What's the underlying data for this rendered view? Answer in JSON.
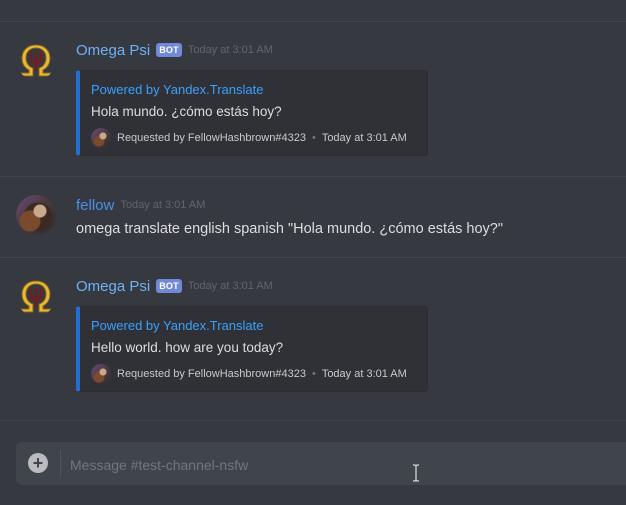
{
  "channel": {
    "composer_placeholder": "Message #test-channel-nsfw"
  },
  "messages": [
    {
      "author": "Omega Psi",
      "bot_tag": "BOT",
      "timestamp": "Today at 3:01 AM",
      "embed": {
        "title": "Powered by Yandex.Translate",
        "description": "Hola mundo. ¿cómo estás hoy?",
        "footer_text": "Requested by FellowHashbrown#4323",
        "footer_separator": "•",
        "footer_timestamp": "Today at 3:01 AM",
        "accent_color": "#1f6fd6"
      }
    },
    {
      "author": "fellow",
      "timestamp": "Today at 3:01 AM",
      "content": "omega translate english spanish \"Hola mundo. ¿cómo estás hoy?\""
    },
    {
      "author": "Omega Psi",
      "bot_tag": "BOT",
      "timestamp": "Today at 3:01 AM",
      "embed": {
        "title": "Powered by Yandex.Translate",
        "description": "Hello world. how are you today?",
        "footer_text": "Requested by FellowHashbrown#4323",
        "footer_separator": "•",
        "footer_timestamp": "Today at 3:01 AM",
        "accent_color": "#1f6fd6"
      }
    }
  ],
  "icons": {
    "bot_avatar": "omega-psi-icon",
    "user_avatar": "user-avatar",
    "composer_plus": "plus-icon",
    "text_cursor": "text-cursor-icon"
  },
  "colors": {
    "background": "#36393f",
    "bot_name": "#6fb1f7",
    "user_name": "#4c8fe8",
    "bot_tag": "#7289da",
    "embed_background": "#2f3136",
    "link": "#3aa0ff"
  }
}
